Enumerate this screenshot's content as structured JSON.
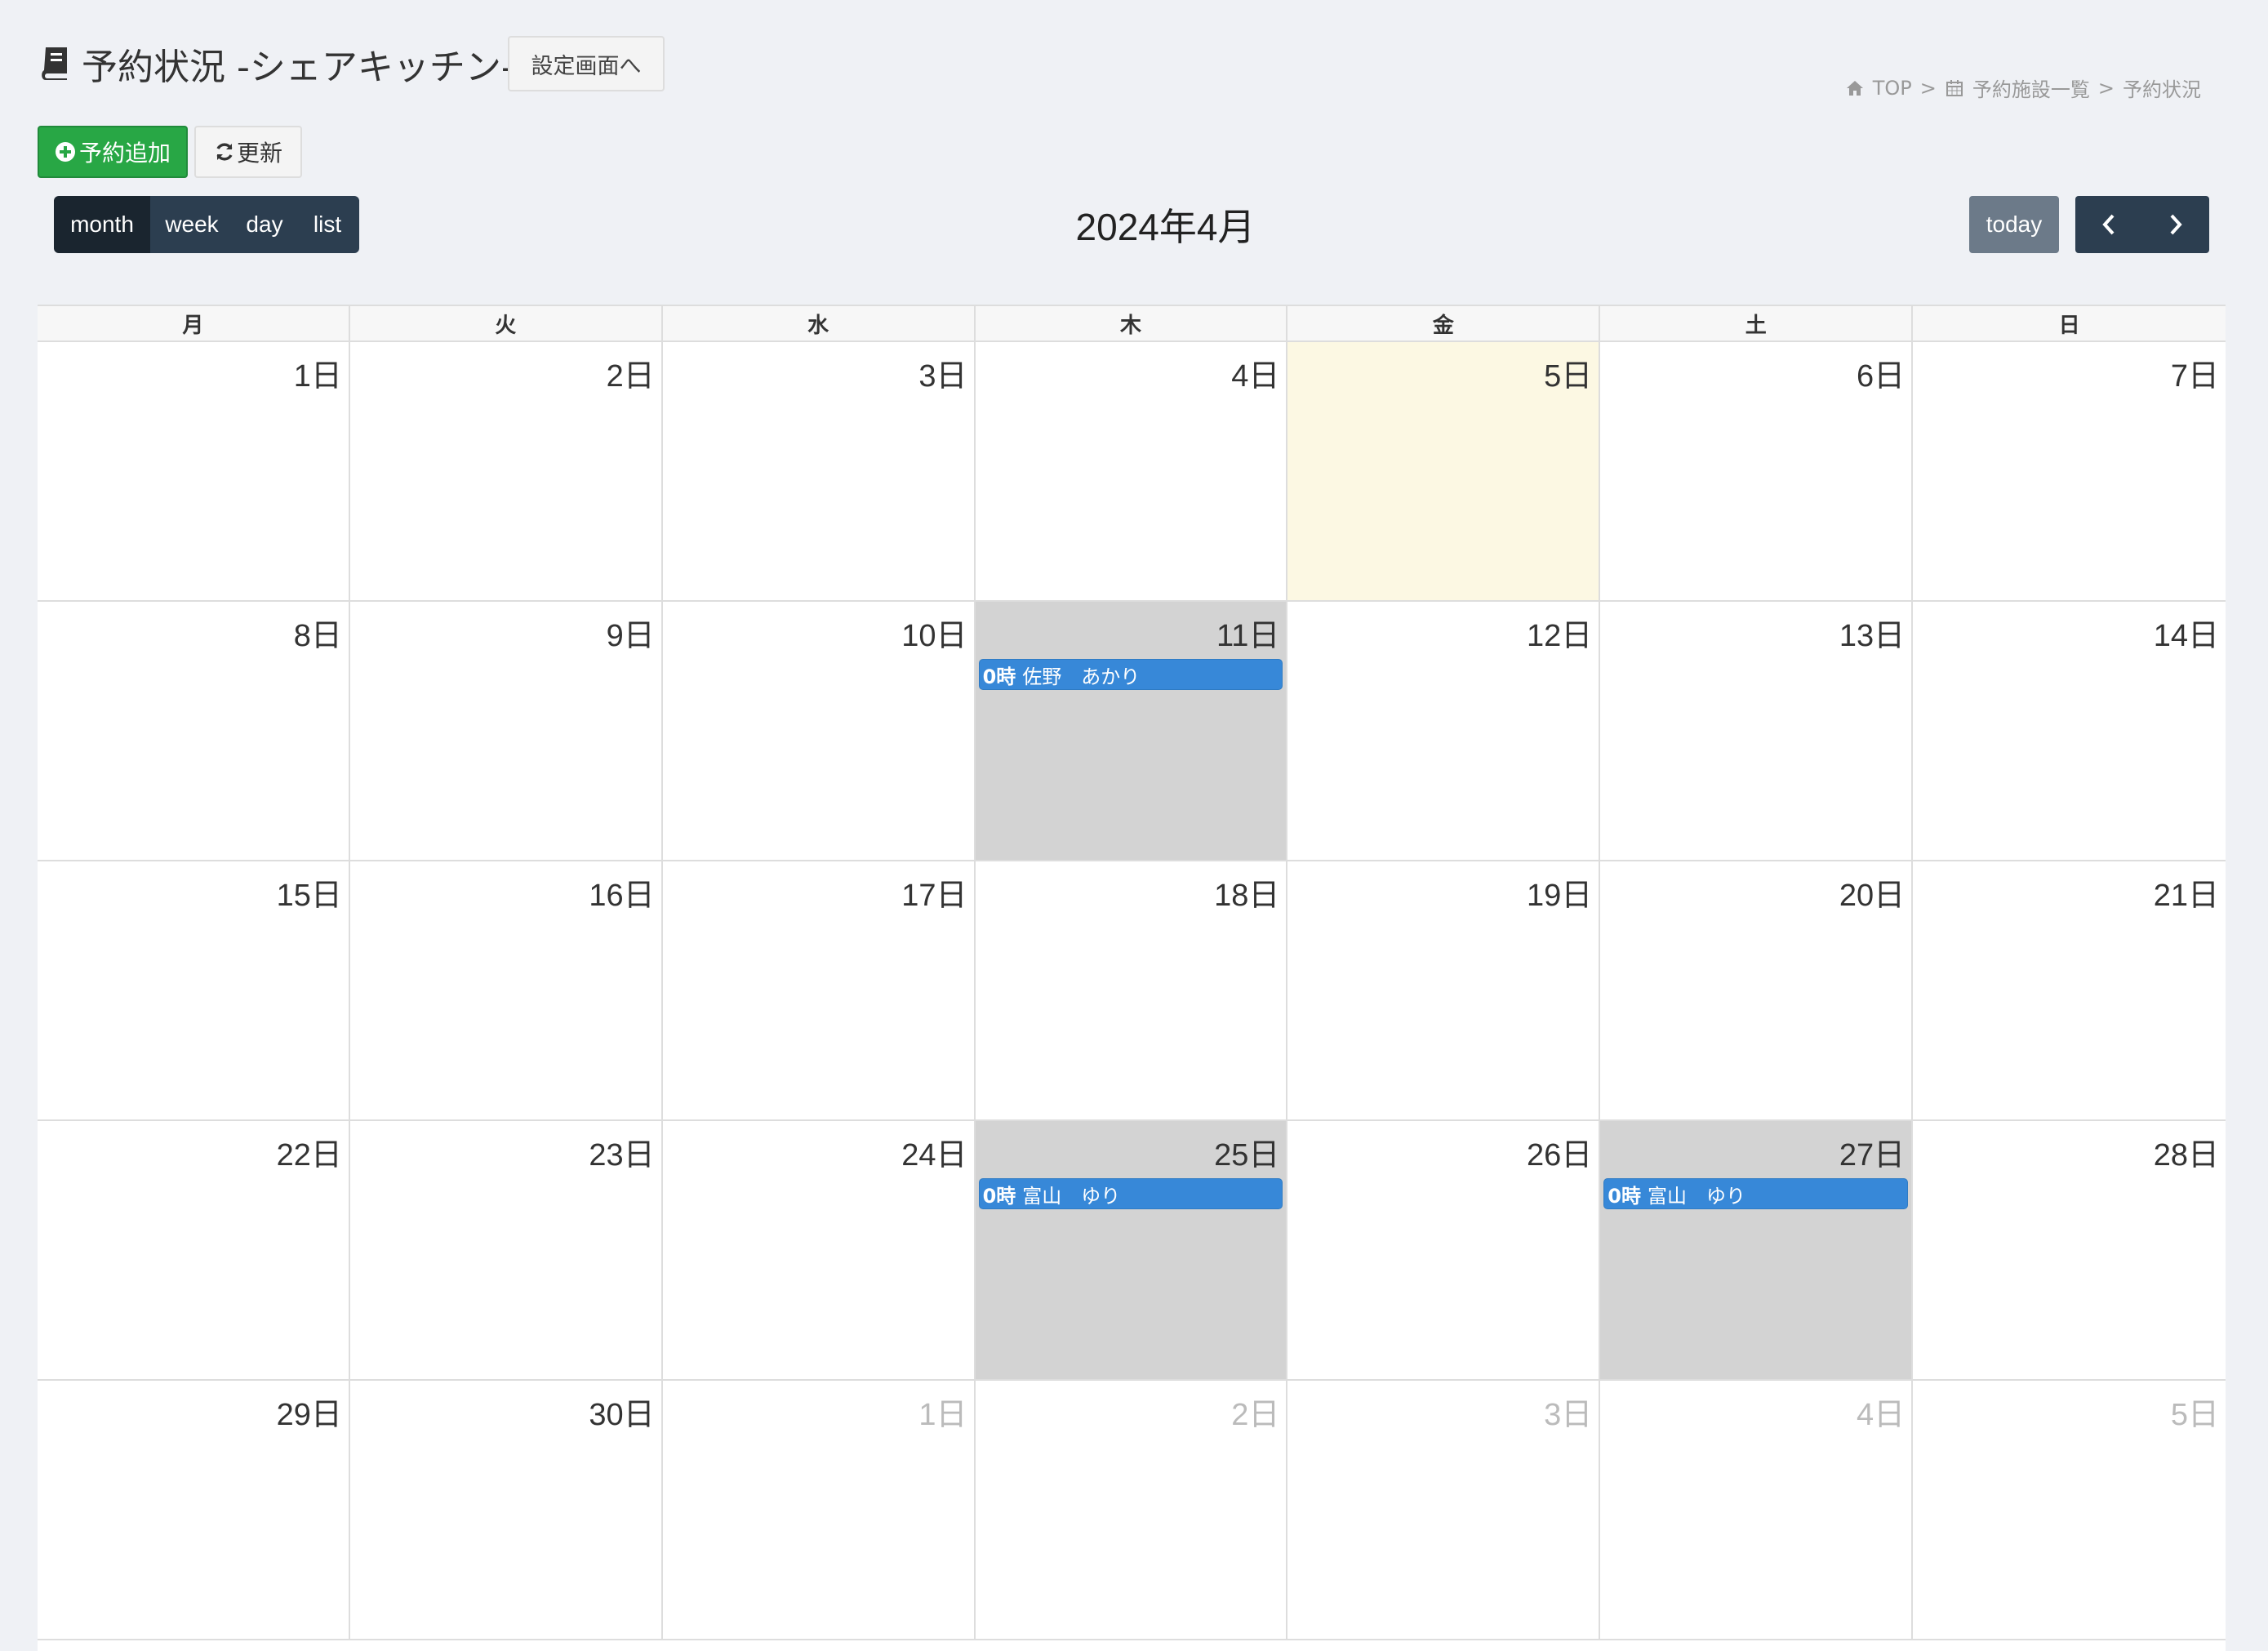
{
  "header": {
    "title": "予約状況 -シェアキッチン-",
    "settings_label": "設定画面へ"
  },
  "breadcrumb": {
    "top": "TOP",
    "sep": ">",
    "facilities": "予約施設一覧",
    "current": "予約状況"
  },
  "actions": {
    "add_label": "予約追加",
    "refresh_label": "更新"
  },
  "views": {
    "month": "month",
    "week": "week",
    "day": "day",
    "list": "list",
    "active": "month"
  },
  "calendar": {
    "title": "2024年4月",
    "today_label": "today",
    "weekdays": [
      "月",
      "火",
      "水",
      "木",
      "金",
      "土",
      "日"
    ],
    "days": [
      {
        "label": "1日",
        "other": false,
        "today": false,
        "booked": false
      },
      {
        "label": "2日",
        "other": false,
        "today": false,
        "booked": false
      },
      {
        "label": "3日",
        "other": false,
        "today": false,
        "booked": false
      },
      {
        "label": "4日",
        "other": false,
        "today": false,
        "booked": false
      },
      {
        "label": "5日",
        "other": false,
        "today": true,
        "booked": false
      },
      {
        "label": "6日",
        "other": false,
        "today": false,
        "booked": false
      },
      {
        "label": "7日",
        "other": false,
        "today": false,
        "booked": false
      },
      {
        "label": "8日",
        "other": false,
        "today": false,
        "booked": false
      },
      {
        "label": "9日",
        "other": false,
        "today": false,
        "booked": false
      },
      {
        "label": "10日",
        "other": false,
        "today": false,
        "booked": false
      },
      {
        "label": "11日",
        "other": false,
        "today": false,
        "booked": true,
        "event": {
          "time": "0時",
          "name": "佐野　あかり"
        }
      },
      {
        "label": "12日",
        "other": false,
        "today": false,
        "booked": false
      },
      {
        "label": "13日",
        "other": false,
        "today": false,
        "booked": false
      },
      {
        "label": "14日",
        "other": false,
        "today": false,
        "booked": false
      },
      {
        "label": "15日",
        "other": false,
        "today": false,
        "booked": false
      },
      {
        "label": "16日",
        "other": false,
        "today": false,
        "booked": false
      },
      {
        "label": "17日",
        "other": false,
        "today": false,
        "booked": false
      },
      {
        "label": "18日",
        "other": false,
        "today": false,
        "booked": false
      },
      {
        "label": "19日",
        "other": false,
        "today": false,
        "booked": false
      },
      {
        "label": "20日",
        "other": false,
        "today": false,
        "booked": false
      },
      {
        "label": "21日",
        "other": false,
        "today": false,
        "booked": false
      },
      {
        "label": "22日",
        "other": false,
        "today": false,
        "booked": false
      },
      {
        "label": "23日",
        "other": false,
        "today": false,
        "booked": false
      },
      {
        "label": "24日",
        "other": false,
        "today": false,
        "booked": false
      },
      {
        "label": "25日",
        "other": false,
        "today": false,
        "booked": true,
        "event": {
          "time": "0時",
          "name": "富山　ゆり"
        }
      },
      {
        "label": "26日",
        "other": false,
        "today": false,
        "booked": false
      },
      {
        "label": "27日",
        "other": false,
        "today": false,
        "booked": true,
        "event": {
          "time": "0時",
          "name": "富山　ゆり"
        }
      },
      {
        "label": "28日",
        "other": false,
        "today": false,
        "booked": false
      },
      {
        "label": "29日",
        "other": false,
        "today": false,
        "booked": false
      },
      {
        "label": "30日",
        "other": false,
        "today": false,
        "booked": false
      },
      {
        "label": "1日",
        "other": true,
        "today": false,
        "booked": false
      },
      {
        "label": "2日",
        "other": true,
        "today": false,
        "booked": false
      },
      {
        "label": "3日",
        "other": true,
        "today": false,
        "booked": false
      },
      {
        "label": "4日",
        "other": true,
        "today": false,
        "booked": false
      },
      {
        "label": "5日",
        "other": true,
        "today": false,
        "booked": false
      }
    ]
  },
  "colors": {
    "add_button": "#28a745",
    "toolbar_dark": "#2c3e50",
    "today_cell": "#fcf8e3",
    "booked_cell": "#d3d3d3",
    "event": "#3788d8"
  }
}
